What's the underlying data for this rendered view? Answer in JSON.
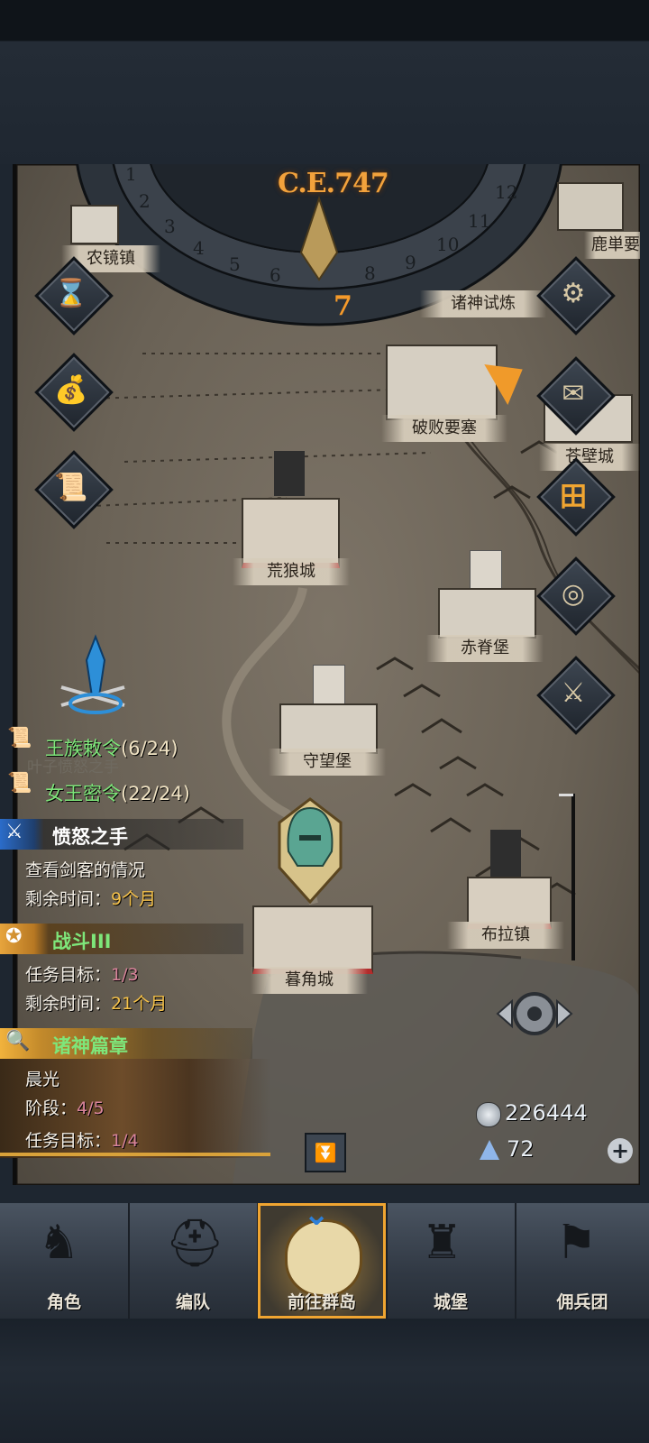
{
  "calendar": {
    "era": "C.E.747",
    "current_month": "7",
    "month_numbers": [
      "1",
      "2",
      "3",
      "4",
      "5",
      "6",
      "8",
      "9",
      "10",
      "11",
      "12"
    ]
  },
  "towns": {
    "nongjing": "农镜镇",
    "trial": "诸神试炼",
    "lu": "鹿単要",
    "pobai": "破败要塞",
    "bicheng": "苍壁城",
    "huanglang": "荒狼城",
    "chiji": "赤脊堡",
    "shouwang": "守望堡",
    "bula": "布拉镇",
    "mujiao": "暮角城"
  },
  "side_icons": [
    "hourglass-icon",
    "pouch-icon",
    "scroll-icon",
    "gear-icon",
    "mail-icon",
    "building-icon",
    "shield-icon",
    "helmet-icon"
  ],
  "quests": {
    "royal": {
      "title": "王族敕令",
      "count": "(6/24)"
    },
    "queen": {
      "title": "女王密令",
      "count": "(22/24)"
    },
    "faded_text": "叶子愤怒之手",
    "anger": {
      "title": "愤怒之手",
      "desc": "查看剑客的情况",
      "time_label": "剩余时间：",
      "time_value": "9个月"
    },
    "battle": {
      "title": "战斗III",
      "goal_label": "任务目标：",
      "goal_value": "1/3",
      "time_label": "剩余时间：",
      "time_value": "21个月"
    },
    "gods": {
      "title": "诸神篇章",
      "subtitle": "晨光",
      "stage_label": "阶段：",
      "stage_value": "4/5",
      "goal_label": "任务目标：",
      "goal_value": "1/4"
    }
  },
  "resources": {
    "silver": "226444",
    "crystal": "72"
  },
  "nav": [
    {
      "label": "角色"
    },
    {
      "label": "编队"
    },
    {
      "label": "前往群岛"
    },
    {
      "label": "城堡"
    },
    {
      "label": "佣兵团"
    }
  ],
  "colors": {
    "accent": "#f0a531",
    "quest_green": "#7ee67a",
    "value_gold": "#f6c24a"
  }
}
